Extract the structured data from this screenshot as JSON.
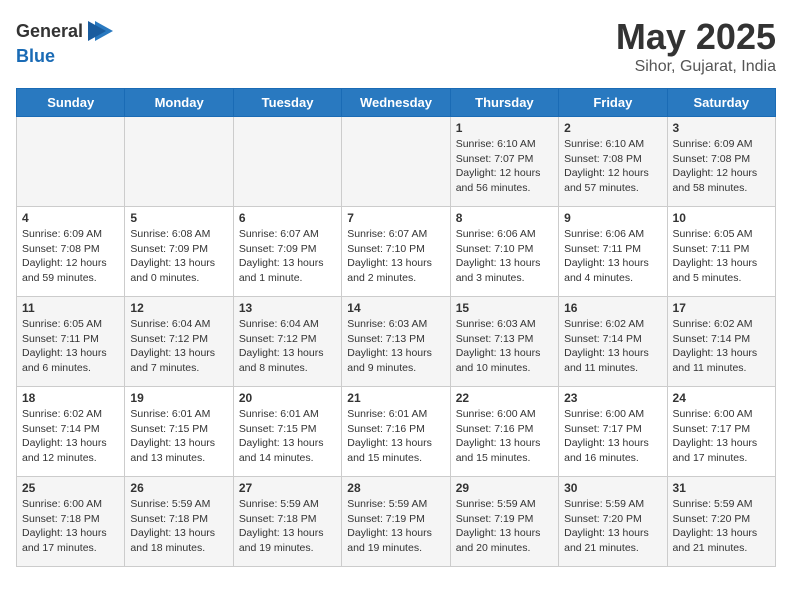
{
  "logo": {
    "general": "General",
    "blue": "Blue"
  },
  "title": "May 2025",
  "subtitle": "Sihor, Gujarat, India",
  "days_of_week": [
    "Sunday",
    "Monday",
    "Tuesday",
    "Wednesday",
    "Thursday",
    "Friday",
    "Saturday"
  ],
  "weeks": [
    [
      {
        "day": "",
        "content": ""
      },
      {
        "day": "",
        "content": ""
      },
      {
        "day": "",
        "content": ""
      },
      {
        "day": "",
        "content": ""
      },
      {
        "day": "1",
        "content": "Sunrise: 6:10 AM\nSunset: 7:07 PM\nDaylight: 12 hours\nand 56 minutes."
      },
      {
        "day": "2",
        "content": "Sunrise: 6:10 AM\nSunset: 7:08 PM\nDaylight: 12 hours\nand 57 minutes."
      },
      {
        "day": "3",
        "content": "Sunrise: 6:09 AM\nSunset: 7:08 PM\nDaylight: 12 hours\nand 58 minutes."
      }
    ],
    [
      {
        "day": "4",
        "content": "Sunrise: 6:09 AM\nSunset: 7:08 PM\nDaylight: 12 hours\nand 59 minutes."
      },
      {
        "day": "5",
        "content": "Sunrise: 6:08 AM\nSunset: 7:09 PM\nDaylight: 13 hours\nand 0 minutes."
      },
      {
        "day": "6",
        "content": "Sunrise: 6:07 AM\nSunset: 7:09 PM\nDaylight: 13 hours\nand 1 minute."
      },
      {
        "day": "7",
        "content": "Sunrise: 6:07 AM\nSunset: 7:10 PM\nDaylight: 13 hours\nand 2 minutes."
      },
      {
        "day": "8",
        "content": "Sunrise: 6:06 AM\nSunset: 7:10 PM\nDaylight: 13 hours\nand 3 minutes."
      },
      {
        "day": "9",
        "content": "Sunrise: 6:06 AM\nSunset: 7:11 PM\nDaylight: 13 hours\nand 4 minutes."
      },
      {
        "day": "10",
        "content": "Sunrise: 6:05 AM\nSunset: 7:11 PM\nDaylight: 13 hours\nand 5 minutes."
      }
    ],
    [
      {
        "day": "11",
        "content": "Sunrise: 6:05 AM\nSunset: 7:11 PM\nDaylight: 13 hours\nand 6 minutes."
      },
      {
        "day": "12",
        "content": "Sunrise: 6:04 AM\nSunset: 7:12 PM\nDaylight: 13 hours\nand 7 minutes."
      },
      {
        "day": "13",
        "content": "Sunrise: 6:04 AM\nSunset: 7:12 PM\nDaylight: 13 hours\nand 8 minutes."
      },
      {
        "day": "14",
        "content": "Sunrise: 6:03 AM\nSunset: 7:13 PM\nDaylight: 13 hours\nand 9 minutes."
      },
      {
        "day": "15",
        "content": "Sunrise: 6:03 AM\nSunset: 7:13 PM\nDaylight: 13 hours\nand 10 minutes."
      },
      {
        "day": "16",
        "content": "Sunrise: 6:02 AM\nSunset: 7:14 PM\nDaylight: 13 hours\nand 11 minutes."
      },
      {
        "day": "17",
        "content": "Sunrise: 6:02 AM\nSunset: 7:14 PM\nDaylight: 13 hours\nand 11 minutes."
      }
    ],
    [
      {
        "day": "18",
        "content": "Sunrise: 6:02 AM\nSunset: 7:14 PM\nDaylight: 13 hours\nand 12 minutes."
      },
      {
        "day": "19",
        "content": "Sunrise: 6:01 AM\nSunset: 7:15 PM\nDaylight: 13 hours\nand 13 minutes."
      },
      {
        "day": "20",
        "content": "Sunrise: 6:01 AM\nSunset: 7:15 PM\nDaylight: 13 hours\nand 14 minutes."
      },
      {
        "day": "21",
        "content": "Sunrise: 6:01 AM\nSunset: 7:16 PM\nDaylight: 13 hours\nand 15 minutes."
      },
      {
        "day": "22",
        "content": "Sunrise: 6:00 AM\nSunset: 7:16 PM\nDaylight: 13 hours\nand 15 minutes."
      },
      {
        "day": "23",
        "content": "Sunrise: 6:00 AM\nSunset: 7:17 PM\nDaylight: 13 hours\nand 16 minutes."
      },
      {
        "day": "24",
        "content": "Sunrise: 6:00 AM\nSunset: 7:17 PM\nDaylight: 13 hours\nand 17 minutes."
      }
    ],
    [
      {
        "day": "25",
        "content": "Sunrise: 6:00 AM\nSunset: 7:18 PM\nDaylight: 13 hours\nand 17 minutes."
      },
      {
        "day": "26",
        "content": "Sunrise: 5:59 AM\nSunset: 7:18 PM\nDaylight: 13 hours\nand 18 minutes."
      },
      {
        "day": "27",
        "content": "Sunrise: 5:59 AM\nSunset: 7:18 PM\nDaylight: 13 hours\nand 19 minutes."
      },
      {
        "day": "28",
        "content": "Sunrise: 5:59 AM\nSunset: 7:19 PM\nDaylight: 13 hours\nand 19 minutes."
      },
      {
        "day": "29",
        "content": "Sunrise: 5:59 AM\nSunset: 7:19 PM\nDaylight: 13 hours\nand 20 minutes."
      },
      {
        "day": "30",
        "content": "Sunrise: 5:59 AM\nSunset: 7:20 PM\nDaylight: 13 hours\nand 21 minutes."
      },
      {
        "day": "31",
        "content": "Sunrise: 5:59 AM\nSunset: 7:20 PM\nDaylight: 13 hours\nand 21 minutes."
      }
    ]
  ]
}
